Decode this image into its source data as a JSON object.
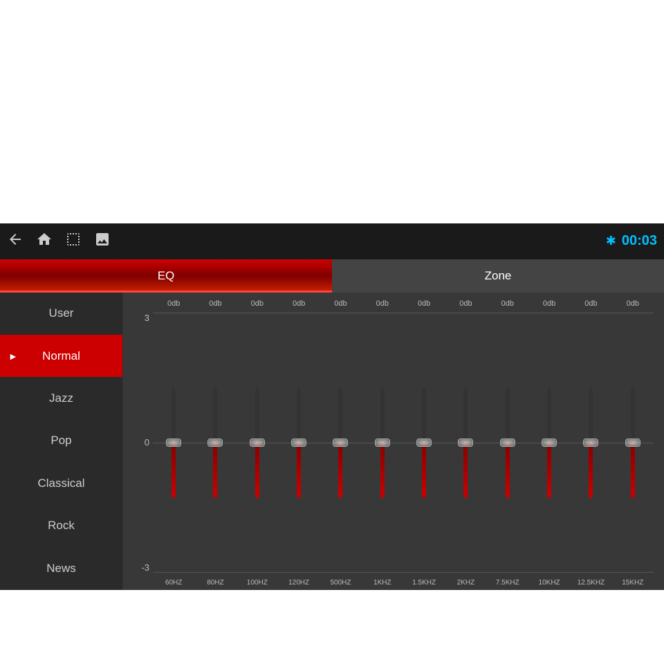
{
  "topbar": {
    "time": "00:03",
    "icons": {
      "back": "back-icon",
      "home": "home-icon",
      "window": "window-icon",
      "image": "image-icon",
      "bluetooth": "bluetooth-icon"
    }
  },
  "tabs": [
    {
      "id": "eq",
      "label": "EQ",
      "active": true
    },
    {
      "id": "zone",
      "label": "Zone",
      "active": false
    }
  ],
  "sidebar": {
    "items": [
      {
        "id": "user",
        "label": "User",
        "active": false
      },
      {
        "id": "normal",
        "label": "Normal",
        "active": true
      },
      {
        "id": "jazz",
        "label": "Jazz",
        "active": false
      },
      {
        "id": "pop",
        "label": "Pop",
        "active": false
      },
      {
        "id": "classical",
        "label": "Classical",
        "active": false
      },
      {
        "id": "rock",
        "label": "Rock",
        "active": false
      },
      {
        "id": "news",
        "label": "News",
        "active": false
      }
    ]
  },
  "eq": {
    "scale": {
      "top": "3",
      "mid": "0",
      "bot": "-3"
    },
    "bands": [
      {
        "freq": "60HZ",
        "db": "0db",
        "value": 0
      },
      {
        "freq": "80HZ",
        "db": "0db",
        "value": 0
      },
      {
        "freq": "100HZ",
        "db": "0db",
        "value": 0
      },
      {
        "freq": "120HZ",
        "db": "0db",
        "value": 0
      },
      {
        "freq": "500HZ",
        "db": "0db",
        "value": 0
      },
      {
        "freq": "1KHZ",
        "db": "0db",
        "value": 0
      },
      {
        "freq": "1.5KHZ",
        "db": "0db",
        "value": 0
      },
      {
        "freq": "2KHZ",
        "db": "0db",
        "value": 0
      },
      {
        "freq": "7.5KHZ",
        "db": "0db",
        "value": 0
      },
      {
        "freq": "10KHZ",
        "db": "0db",
        "value": 0
      },
      {
        "freq": "12.5KHZ",
        "db": "0db",
        "value": 0
      },
      {
        "freq": "15KHZ",
        "db": "0db",
        "value": 0
      }
    ]
  }
}
